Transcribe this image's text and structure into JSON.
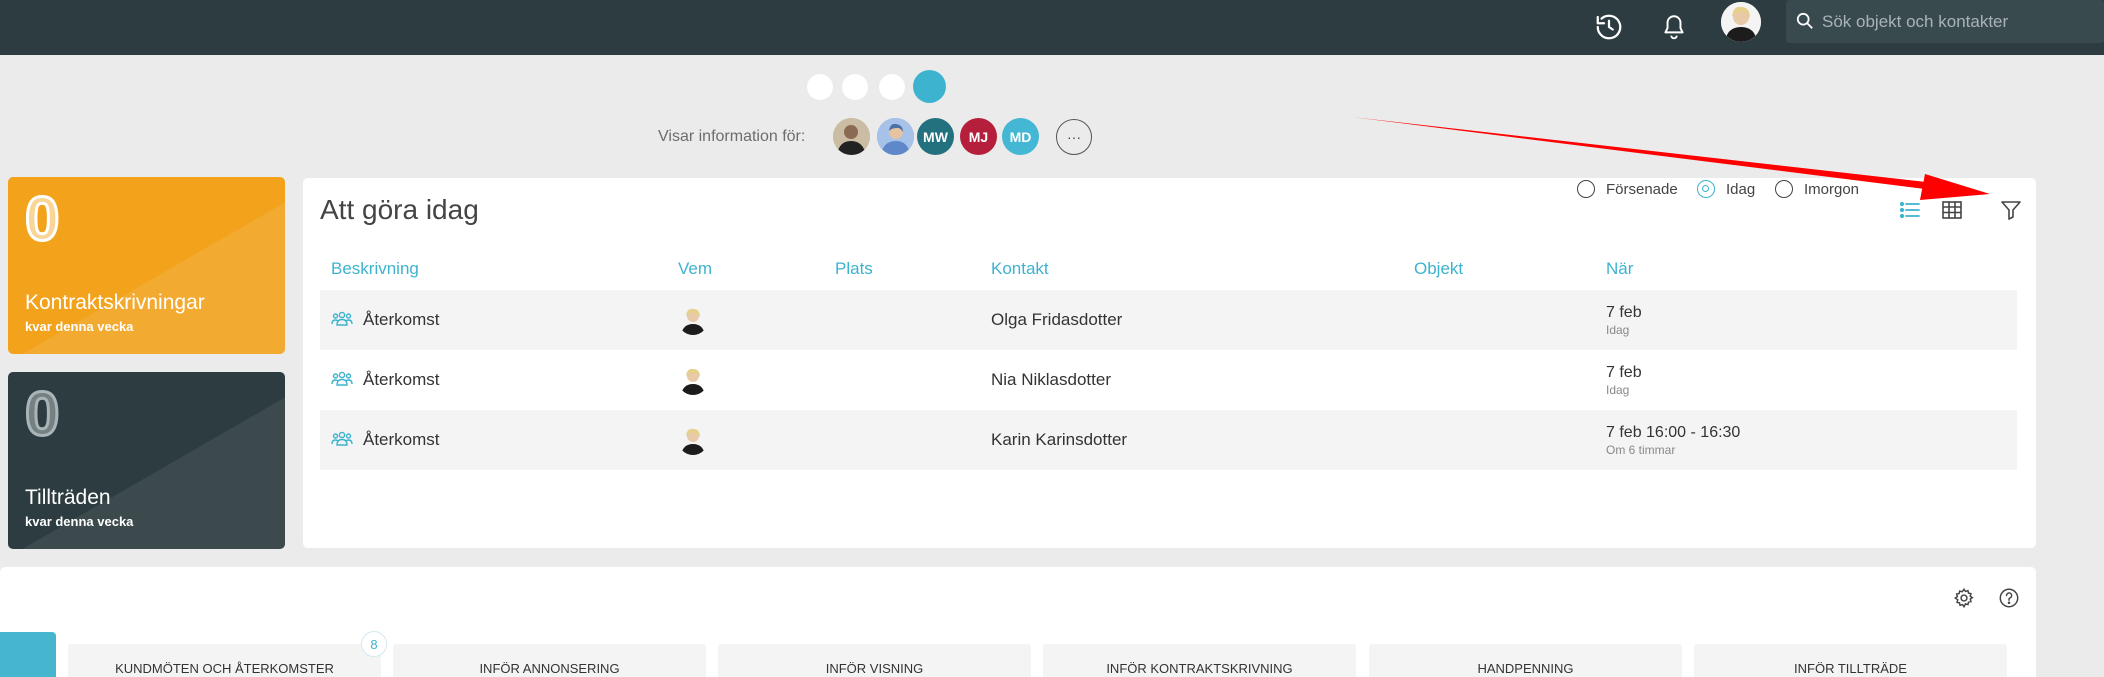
{
  "topbar": {
    "search_placeholder": "Sök objekt och kontakter",
    "icons": [
      "history-icon",
      "bell-icon",
      "user-avatar"
    ]
  },
  "viewing": {
    "label": "Visar information för:",
    "people": [
      {
        "initials": "",
        "color": "#c9b89c"
      },
      {
        "initials": "",
        "color": "#6e9ad6"
      },
      {
        "initials": "MW",
        "color": "#23707e"
      },
      {
        "initials": "MJ",
        "color": "#b51f3c"
      },
      {
        "initials": "MD",
        "color": "#43b7d3"
      }
    ],
    "more_label": "···"
  },
  "cards": [
    {
      "count": "0",
      "title": "Kontraktskrivningar",
      "sub": "kvar denna vecka",
      "color": "#f2a21b"
    },
    {
      "count": "0",
      "title": "Tillträden",
      "sub": "kvar denna vecka",
      "color": "#2d3c40"
    }
  ],
  "todo": {
    "title": "Att göra idag",
    "filters": [
      {
        "label": "Försenade",
        "selected": false
      },
      {
        "label": "Idag",
        "selected": true
      },
      {
        "label": "Imorgon",
        "selected": false
      }
    ],
    "columns": [
      "Beskrivning",
      "Vem",
      "Plats",
      "Kontakt",
      "Objekt",
      "När"
    ],
    "rows": [
      {
        "desc": "Återkomst",
        "place": "",
        "contact": "Olga Fridasdotter",
        "object": "",
        "when": "7 feb",
        "when_sub": "Idag"
      },
      {
        "desc": "Återkomst",
        "place": "",
        "contact": "Nia Niklasdotter",
        "object": "",
        "when": "7 feb",
        "when_sub": "Idag"
      },
      {
        "desc": "Återkomst",
        "place": "",
        "contact": "Karin Karinsdotter",
        "object": "",
        "when": "7 feb 16:00 - 16:30",
        "when_sub": "Om 6 timmar"
      }
    ]
  },
  "pipeline": {
    "columns": [
      "KUNDMÖTEN OCH ÅTERKOMSTER",
      "INFÖR ANNONSERING",
      "INFÖR VISNING",
      "INFÖR KONTRAKTSKRIVNING",
      "HANDPENNING",
      "INFÖR TILLTRÄDE"
    ],
    "badge_count": "8"
  },
  "colors": {
    "accent": "#3db3cf",
    "topbar": "#2d3c40",
    "annotation": "#ff0000"
  }
}
